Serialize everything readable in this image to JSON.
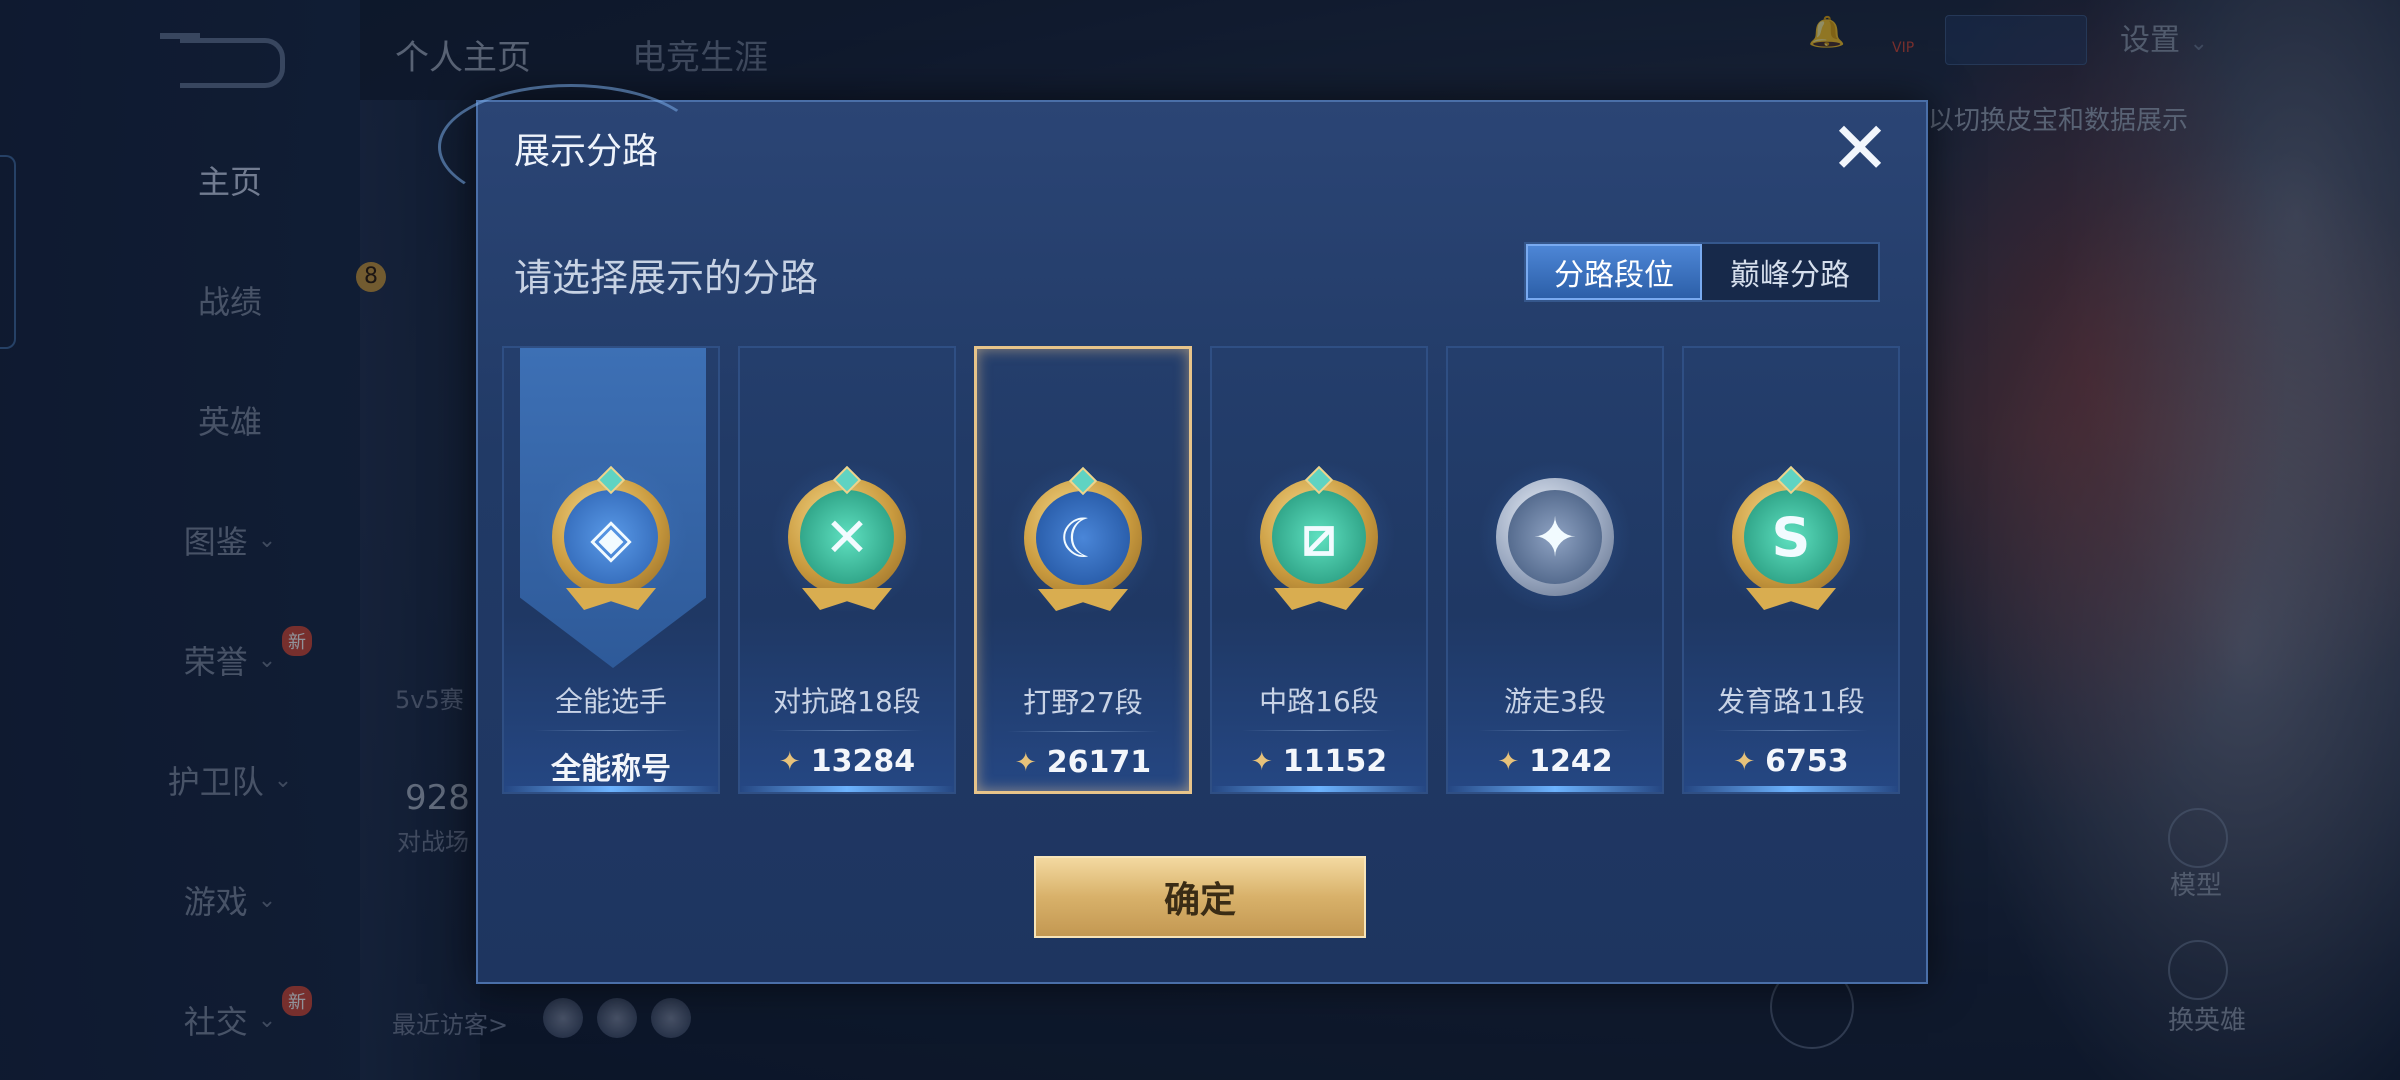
{
  "background": {
    "top_tabs": [
      "个人主页",
      "电竞生涯"
    ],
    "nav": [
      {
        "label": "主页",
        "has_chevron": false,
        "new": false
      },
      {
        "label": "战绩",
        "has_chevron": false,
        "new": false
      },
      {
        "label": "英雄",
        "has_chevron": false,
        "new": false
      },
      {
        "label": "图鉴",
        "has_chevron": true,
        "new": false
      },
      {
        "label": "荣誉",
        "has_chevron": true,
        "new": true
      },
      {
        "label": "护卫队",
        "has_chevron": true,
        "new": false
      },
      {
        "label": "游戏",
        "has_chevron": true,
        "new": false
      },
      {
        "label": "社交",
        "has_chevron": true,
        "new": true
      }
    ],
    "new_badge_text": "新",
    "level_badge": "8",
    "mode_text": "5v5赛",
    "stat_number": "928",
    "stat_label": "对战场",
    "recent_visitors": "最近访客>",
    "settings_label": "设置",
    "vip_label": "VIP",
    "hint_text": "以切换皮宝和数据展示",
    "model_label": "模型",
    "switch_hero_label": "换英雄"
  },
  "dialog": {
    "title": "展示分路",
    "subtitle": "请选择展示的分路",
    "close_icon": "close-icon",
    "segment": [
      "分路段位",
      "巅峰分路"
    ],
    "active_segment": 0,
    "cards": [
      {
        "label": "全能选手",
        "value": "全能称号",
        "icon": "all-round-icon",
        "glyph": "◈",
        "color": "#3b78c8",
        "selected": false,
        "highlight": true
      },
      {
        "label": "对抗路18段",
        "value": "13284",
        "icon": "clash-lane-icon",
        "glyph": "✕",
        "color": "#35b89a",
        "selected": false,
        "highlight": false
      },
      {
        "label": "打野27段",
        "value": "26171",
        "icon": "jungle-dragon-icon",
        "glyph": "☾",
        "color": "#2e63b5",
        "selected": true,
        "highlight": false
      },
      {
        "label": "中路16段",
        "value": "11152",
        "icon": "mid-lane-icon",
        "glyph": "⧄",
        "color": "#35b89a",
        "selected": false,
        "highlight": false
      },
      {
        "label": "游走3段",
        "value": "1242",
        "icon": "roam-icon",
        "glyph": "✦",
        "color": "#7a8aa8",
        "selected": false,
        "highlight": false
      },
      {
        "label": "发育路11段",
        "value": "6753",
        "icon": "farm-lane-icon",
        "glyph": "S",
        "color": "#35b89a",
        "selected": false,
        "highlight": false
      }
    ],
    "confirm_label": "确定"
  }
}
